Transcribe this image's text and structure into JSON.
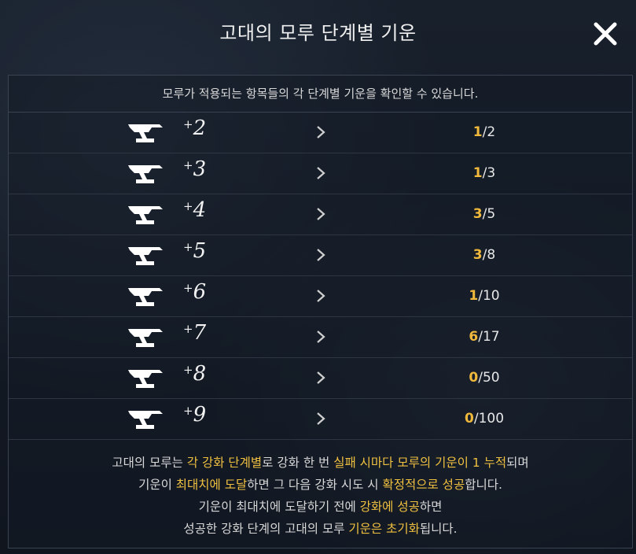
{
  "title": "고대의 모루 단계별 기운",
  "subtitle": "모루가 적용되는 항목들의 각 단계별 기운을 확인할 수 있습니다.",
  "close_icon": "close-icon",
  "rows": [
    {
      "plus": "+",
      "level": "2",
      "current": "1",
      "slash": "/",
      "max": "2"
    },
    {
      "plus": "+",
      "level": "3",
      "current": "1",
      "slash": "/",
      "max": "3"
    },
    {
      "plus": "+",
      "level": "4",
      "current": "3",
      "slash": "/",
      "max": "5"
    },
    {
      "plus": "+",
      "level": "5",
      "current": "3",
      "slash": "/",
      "max": "8"
    },
    {
      "plus": "+",
      "level": "6",
      "current": "1",
      "slash": "/",
      "max": "10"
    },
    {
      "plus": "+",
      "level": "7",
      "current": "6",
      "slash": "/",
      "max": "17"
    },
    {
      "plus": "+",
      "level": "8",
      "current": "0",
      "slash": "/",
      "max": "50"
    },
    {
      "plus": "+",
      "level": "9",
      "current": "0",
      "slash": "/",
      "max": "100"
    }
  ],
  "description": {
    "line1": [
      {
        "t": "고대의 모루는 ",
        "h": false
      },
      {
        "t": "각 강화 단계별",
        "h": true
      },
      {
        "t": "로 강화 한 번 ",
        "h": false
      },
      {
        "t": "실패 시마다 모루의 기운이 1 누적",
        "h": true
      },
      {
        "t": "되며",
        "h": false
      }
    ],
    "line2": [
      {
        "t": "기운이 ",
        "h": false
      },
      {
        "t": "최대치에 도달",
        "h": true
      },
      {
        "t": "하면 그 다음 강화 시도 시 ",
        "h": false
      },
      {
        "t": "확정적으로 성공",
        "h": true
      },
      {
        "t": "합니다.",
        "h": false
      }
    ],
    "line3": [
      {
        "t": "기운이 최대치에 도달하기 전에 ",
        "h": false
      },
      {
        "t": "강화에 성공",
        "h": true
      },
      {
        "t": "하면",
        "h": false
      }
    ],
    "line4": [
      {
        "t": "성공한 강화 단계의 고대의 모루 ",
        "h": false
      },
      {
        "t": "기운은 초기화",
        "h": true
      },
      {
        "t": "됩니다.",
        "h": false
      }
    ]
  },
  "colors": {
    "highlight": "#f0c040",
    "current_value": "#f0b93c",
    "background": "#141a25"
  }
}
